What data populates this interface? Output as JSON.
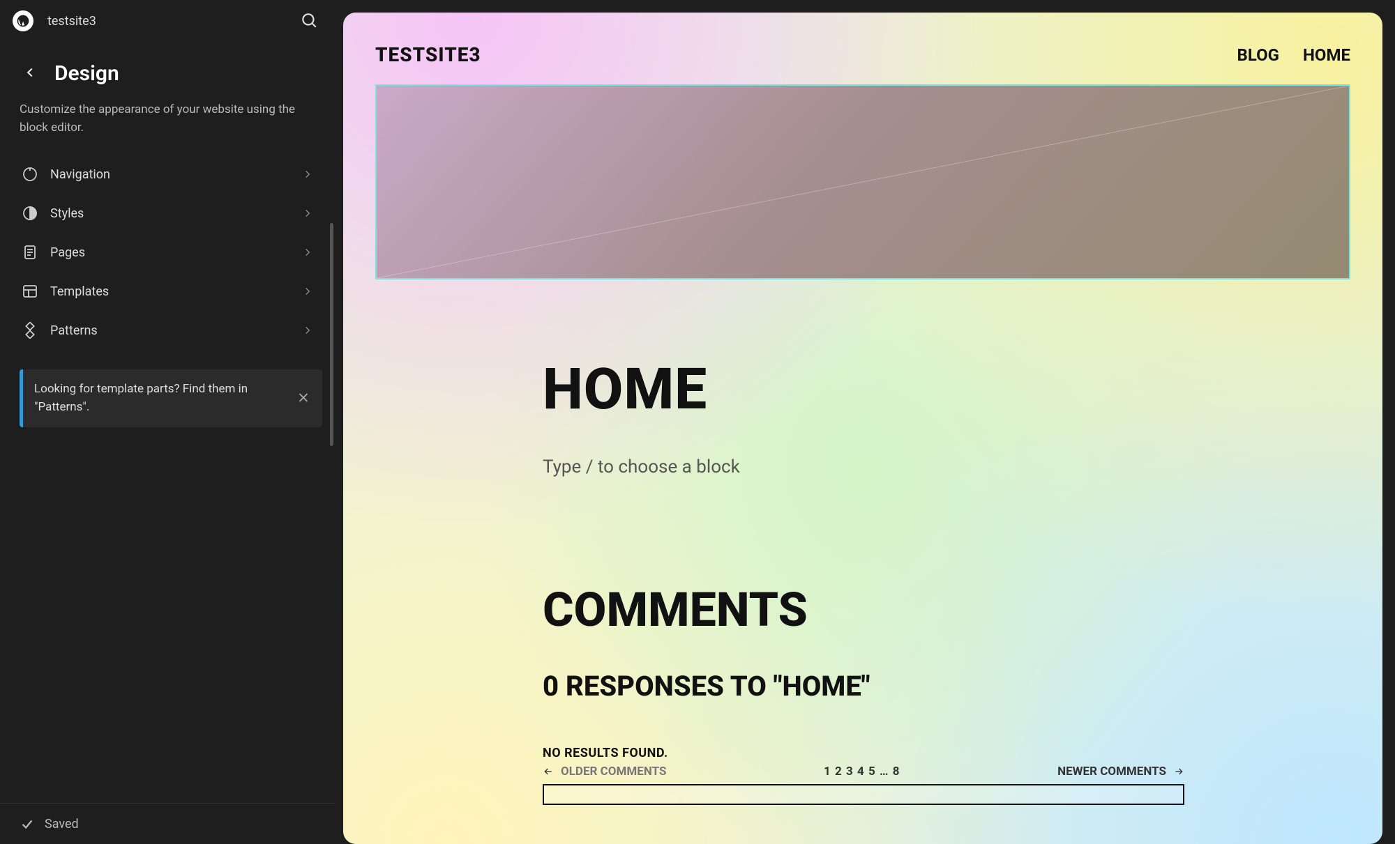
{
  "app": {
    "site_name": "testsite3"
  },
  "panel": {
    "title": "Design",
    "description": "Customize the appearance of your website using the block editor.",
    "items": [
      {
        "label": "Navigation",
        "icon": "compass"
      },
      {
        "label": "Styles",
        "icon": "half-circle"
      },
      {
        "label": "Pages",
        "icon": "page"
      },
      {
        "label": "Templates",
        "icon": "layout"
      },
      {
        "label": "Patterns",
        "icon": "diamond-grid"
      }
    ],
    "notice": "Looking for template parts? Find them in \"Patterns\".",
    "footer_status": "Saved"
  },
  "preview": {
    "site_title": "TESTSITE3",
    "nav": [
      {
        "label": "BLOG"
      },
      {
        "label": "HOME"
      }
    ],
    "page_title": "HOME",
    "block_prompt": "Type / to choose a block",
    "comments_heading": "COMMENTS",
    "responses_heading": "0 RESPONSES TO \"HOME\"",
    "no_results": "NO RESULTS FOUND.",
    "older_label": "OLDER COMMENTS",
    "newer_label": "NEWER COMMENTS",
    "page_numbers": "1 2 3 4 5 … 8"
  }
}
